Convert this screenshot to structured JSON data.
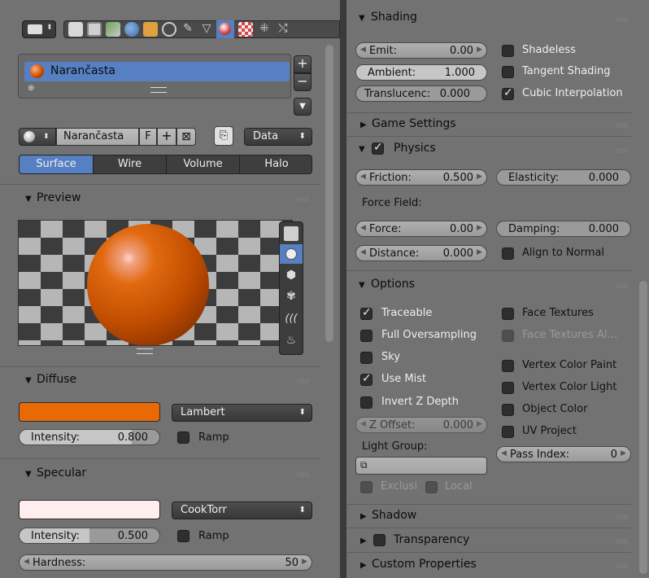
{
  "colors": {
    "panel_bg": "#727272",
    "accent": "#5680c2",
    "material_orange": "#e76a04",
    "specular_color": "#ffeeee"
  },
  "left": {
    "header_icons": [
      "editor-type-icon",
      "render-icon",
      "render-layers-icon",
      "scene-icon",
      "world-icon",
      "object-icon",
      "constraints-icon",
      "modifiers-icon",
      "data-icon",
      "material-icon",
      "texture-icon",
      "particles-icon",
      "physics-icon"
    ],
    "material_slot": {
      "name": "Narančasta"
    },
    "slot_buttons": {
      "add": "+",
      "remove": "−",
      "special": "▼"
    },
    "material_selector": {
      "name": "Narančasta",
      "fake_user": "F",
      "link": "Data"
    },
    "tabs": [
      "Surface",
      "Wire",
      "Volume",
      "Halo"
    ],
    "preview": {
      "title": "Preview"
    },
    "diffuse": {
      "title": "Diffuse",
      "shader": "Lambert",
      "intensity_label": "Intensity:",
      "intensity_value": "0.800",
      "intensity_fraction": 0.8,
      "ramp": "Ramp"
    },
    "specular": {
      "title": "Specular",
      "shader": "CookTorr",
      "intensity_label": "Intensity:",
      "intensity_value": "0.500",
      "intensity_fraction": 0.5,
      "ramp": "Ramp",
      "hardness_label": "Hardness:",
      "hardness_value": "50"
    }
  },
  "right": {
    "shading": {
      "title": "Shading",
      "emit_label": "Emit:",
      "emit_value": "0.00",
      "ambient_label": "Ambient:",
      "ambient_value": "1.000",
      "ambient_fraction": 1.0,
      "translucency_label": "Translucenc:",
      "translucency_value": "0.000",
      "translucency_fraction": 0.0,
      "shadeless": "Shadeless",
      "tangent_shading": "Tangent Shading",
      "cubic_interpolation": "Cubic Interpolation"
    },
    "game_settings": {
      "title": "Game Settings"
    },
    "physics": {
      "title": "Physics",
      "friction_label": "Friction:",
      "friction_value": "0.500",
      "elasticity_label": "Elasticity:",
      "elasticity_value": "0.000",
      "elasticity_fraction": 0.0,
      "force_field_label": "Force Field:",
      "force_label": "Force:",
      "force_value": "0.00",
      "damping_label": "Damping:",
      "damping_value": "0.000",
      "damping_fraction": 0.0,
      "distance_label": "Distance:",
      "distance_value": "0.000",
      "align_to_normal": "Align to Normal"
    },
    "options": {
      "title": "Options",
      "traceable": "Traceable",
      "full_oversampling": "Full Oversampling",
      "sky": "Sky",
      "use_mist": "Use Mist",
      "invert_z_depth": "Invert Z Depth",
      "z_offset_label": "Z Offset:",
      "z_offset_value": "0.000",
      "light_group_label": "Light Group:",
      "exclusive": "Exclusi",
      "local": "Local",
      "face_textures": "Face Textures",
      "face_textures_alpha": "Face Textures Al…",
      "vertex_color_paint": "Vertex Color Paint",
      "vertex_color_light": "Vertex Color Light",
      "object_color": "Object Color",
      "uv_project": "UV Project",
      "pass_index_label": "Pass Index:",
      "pass_index_value": "0"
    },
    "shadow": {
      "title": "Shadow"
    },
    "transparency": {
      "title": "Transparency"
    },
    "custom_properties": {
      "title": "Custom Properties"
    }
  }
}
